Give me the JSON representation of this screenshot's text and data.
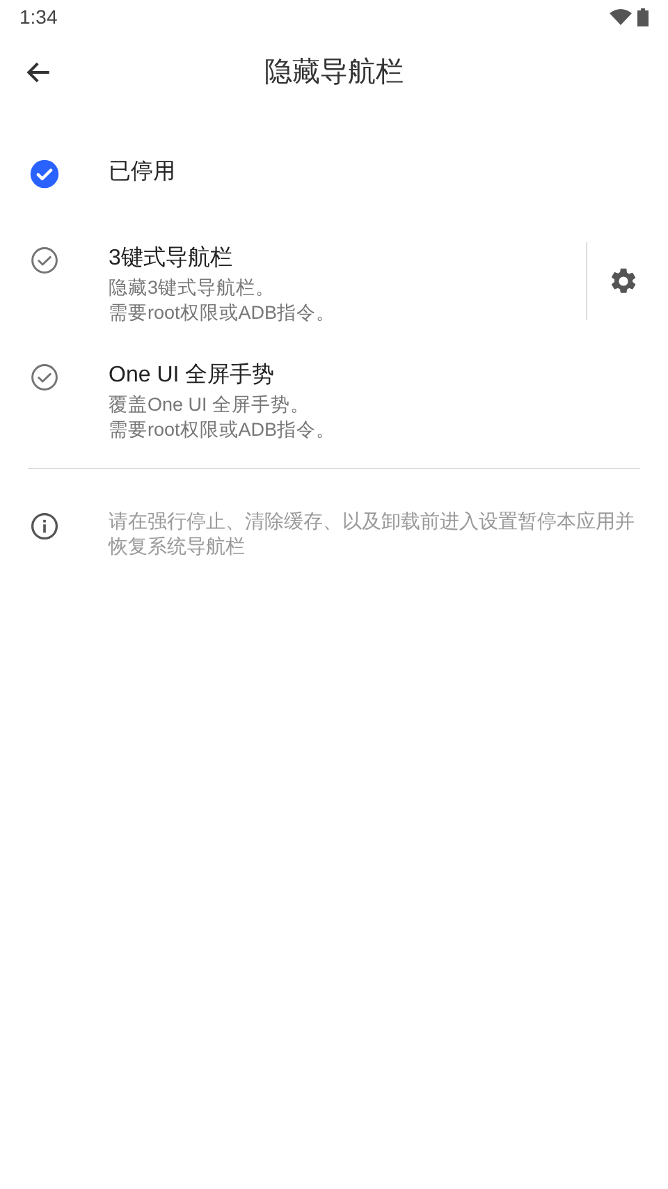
{
  "status_bar": {
    "time": "1:34"
  },
  "app_bar": {
    "title": "隐藏导航栏"
  },
  "options": [
    {
      "title": "已停用",
      "selected": true,
      "has_settings": false
    },
    {
      "title": "3键式导航栏",
      "description": [
        "隐藏3键式导航栏。",
        "需要root权限或ADB指令。"
      ],
      "selected": false,
      "has_settings": true
    },
    {
      "title": "One UI 全屏手势",
      "description": [
        "覆盖One UI 全屏手势。",
        "需要root权限或ADB指令。"
      ],
      "selected": false,
      "has_settings": false
    }
  ],
  "info": {
    "text": "请在强行停止、清除缓存、以及卸载前进入设置暂停本应用并恢复系统导航栏"
  }
}
